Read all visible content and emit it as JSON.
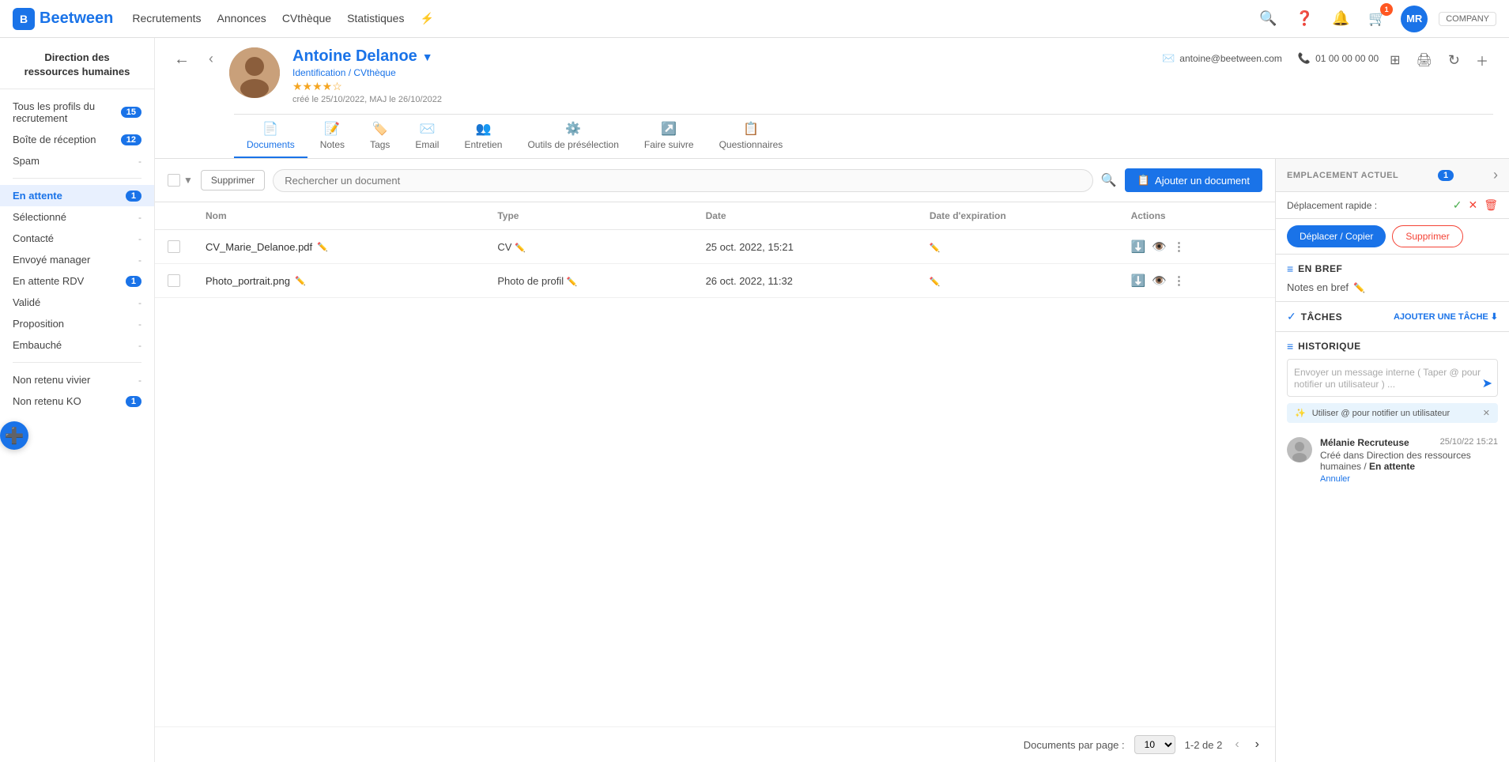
{
  "topnav": {
    "logo_text": "Beetween",
    "logo_letter": "B",
    "links": [
      "Recrutements",
      "Annonces",
      "CVthèque",
      "Statistiques"
    ],
    "bolt_icon": "⚡",
    "search_icon": "🔍",
    "help_icon": "?",
    "notif_icon": "🔔",
    "cart_icon": "🛒",
    "cart_badge": "1",
    "avatar_initials": "MR",
    "company_text": "COMPANY"
  },
  "sidebar": {
    "title": "Direction des\nressources humaines",
    "items": [
      {
        "label": "Tous les profils du recrutement",
        "count": "15",
        "active": false
      },
      {
        "label": "Boîte de réception",
        "count": "12",
        "active": false
      },
      {
        "label": "Spam",
        "count": "-",
        "active": false
      },
      {
        "label": "En attente",
        "count": "1",
        "active": true
      },
      {
        "label": "Sélectionné",
        "count": "-",
        "active": false
      },
      {
        "label": "Contacté",
        "count": "-",
        "active": false
      },
      {
        "label": "Envoyé manager",
        "count": "-",
        "active": false
      },
      {
        "label": "En attente RDV",
        "count": "1",
        "active": false
      },
      {
        "label": "Validé",
        "count": "-",
        "active": false
      },
      {
        "label": "Proposition",
        "count": "-",
        "active": false
      },
      {
        "label": "Embauché",
        "count": "-",
        "active": false
      },
      {
        "label": "Non retenu vivier",
        "count": "-",
        "active": false
      },
      {
        "label": "Non retenu KO",
        "count": "1",
        "active": false
      }
    ]
  },
  "candidate": {
    "name": "Antoine Delanoe",
    "name_dropdown": "▼",
    "link_identification": "Identification / CVthèque",
    "email": "antoine@beetween.com",
    "phone": "01 00 00 00 00",
    "created": "créé le 25/10/2022, MAJ le 26/10/2022",
    "stars": "★★★★☆",
    "tabs": [
      {
        "label": "Documents",
        "icon": "📄",
        "active": true
      },
      {
        "label": "Notes",
        "icon": "📝",
        "active": false
      },
      {
        "label": "Tags",
        "icon": "🏷️",
        "active": false
      },
      {
        "label": "Email",
        "icon": "✉️",
        "active": false
      },
      {
        "label": "Entretien",
        "icon": "👥",
        "active": false
      },
      {
        "label": "Outils de présélection",
        "icon": "⚙️",
        "active": false
      },
      {
        "label": "Faire suivre",
        "icon": "↗️",
        "active": false
      },
      {
        "label": "Questionnaires",
        "icon": "📋",
        "active": false
      }
    ]
  },
  "right_panel": {
    "placement_label": "EMPLACEMENT ACTUEL",
    "placement_badge": "1",
    "quick_move_label": "Déplacement rapide :",
    "btn_move": "Déplacer / Copier",
    "btn_delete": "Supprimer",
    "en_bref_title": "EN BREF",
    "notes_bref_label": "Notes en bref",
    "taches_title": "TÂCHES",
    "ajouter_tache": "AJOUTER UNE TÂCHE",
    "historique_title": "HISTORIQUE",
    "message_placeholder": "Envoyer un message interne ( Taper @ pour notifier un utilisateur ) ...",
    "tip_text": "Utiliser @ pour notifier un utilisateur",
    "history_name": "Mélanie Recruteuse",
    "history_date": "25/10/22 15:21",
    "history_text1": "Créé dans Direction des ressources humaines / ",
    "history_bold": "En attente",
    "history_annuler": "Annuler"
  },
  "documents": {
    "toolbar": {
      "delete_label": "Supprimer",
      "search_placeholder": "Rechercher un document",
      "add_label": "Ajouter un document"
    },
    "table": {
      "headers": [
        "",
        "Nom",
        "Type",
        "Date",
        "Date d'expiration",
        "Actions"
      ],
      "rows": [
        {
          "name": "CV_Marie_Delanoe.pdf",
          "type": "CV",
          "date": "25 oct. 2022, 15:21",
          "expiry": ""
        },
        {
          "name": "Photo_portrait.png",
          "type": "Photo de profil",
          "date": "26 oct. 2022, 11:32",
          "expiry": ""
        }
      ]
    },
    "pagination": {
      "label": "Documents par page :",
      "per_page": "10",
      "range": "1-2 de 2"
    }
  }
}
